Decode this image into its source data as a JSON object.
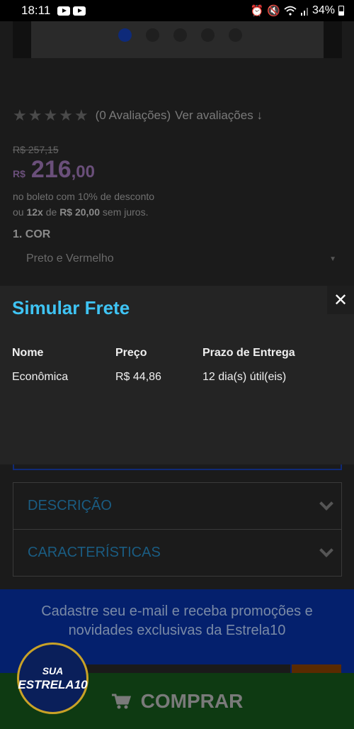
{
  "status_bar": {
    "time": "18:11",
    "battery": "34%"
  },
  "product": {
    "rating_count": "(0 Avaliações)",
    "rating_link": "Ver avaliações",
    "rating_arrow": "↓",
    "old_price": "R$ 257,15",
    "price_currency": "R$",
    "price_integer": "216",
    "price_cents": ",00",
    "boleto_line": "no boleto com 10% de desconto",
    "installments_prefix": "ou",
    "installments_count": "12x",
    "installments_mid": "de",
    "installments_value": "R$ 20,00",
    "installments_suffix": "sem juros.",
    "color_label": "1. COR",
    "color_value": "Preto e Vermelho"
  },
  "modal": {
    "title": "Simular Frete",
    "close": "✕",
    "columns": [
      "Nome",
      "Preço",
      "Prazo de Entrega"
    ],
    "rows": [
      {
        "name": "Econômica",
        "price": "R$ 44,86",
        "deadline": "12 dia(s) útil(eis)"
      }
    ]
  },
  "accordion": [
    {
      "label": "DESCRIÇÃO"
    },
    {
      "label": "CARACTERÍSTICAS"
    }
  ],
  "newsletter": {
    "line1": "Cadastre seu e-mail e receba promoções e",
    "line2": "novidades exclusivas da Estrela10"
  },
  "buy_button": {
    "label": "COMPRAR"
  },
  "badge": {
    "top": "SUA",
    "bottom": "ESTRELA10"
  },
  "carousel": {
    "slide_count": 5,
    "active_index": 0
  }
}
